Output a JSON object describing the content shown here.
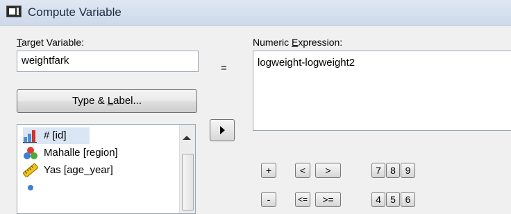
{
  "window": {
    "title": "Compute Variable"
  },
  "target": {
    "label_acc": "T",
    "label_rest": "arget Variable:",
    "value": "weightfark",
    "equals": "="
  },
  "expression": {
    "label_pre": "Numeric ",
    "label_acc": "E",
    "label_rest": "xpression:",
    "value": "logweight-logweight2"
  },
  "type_label_button": {
    "pre": "Type & ",
    "acc": "L",
    "rest": "abel..."
  },
  "variables": [
    {
      "label": "# [id]",
      "icon": "scale-measure-icon"
    },
    {
      "label": "Mahalle [region]",
      "icon": "nominal-measure-icon"
    },
    {
      "label": "Yas [age_year]",
      "icon": "ruler-scale-icon"
    }
  ],
  "keypad": {
    "row1": [
      "+",
      "<",
      ">",
      "7",
      "8",
      "9"
    ],
    "row2": [
      "-",
      "<=",
      ">=",
      "4",
      "5",
      "6"
    ]
  },
  "colors": {
    "selection": "#dbe6f5",
    "titlebar": "#d6e0ee"
  }
}
